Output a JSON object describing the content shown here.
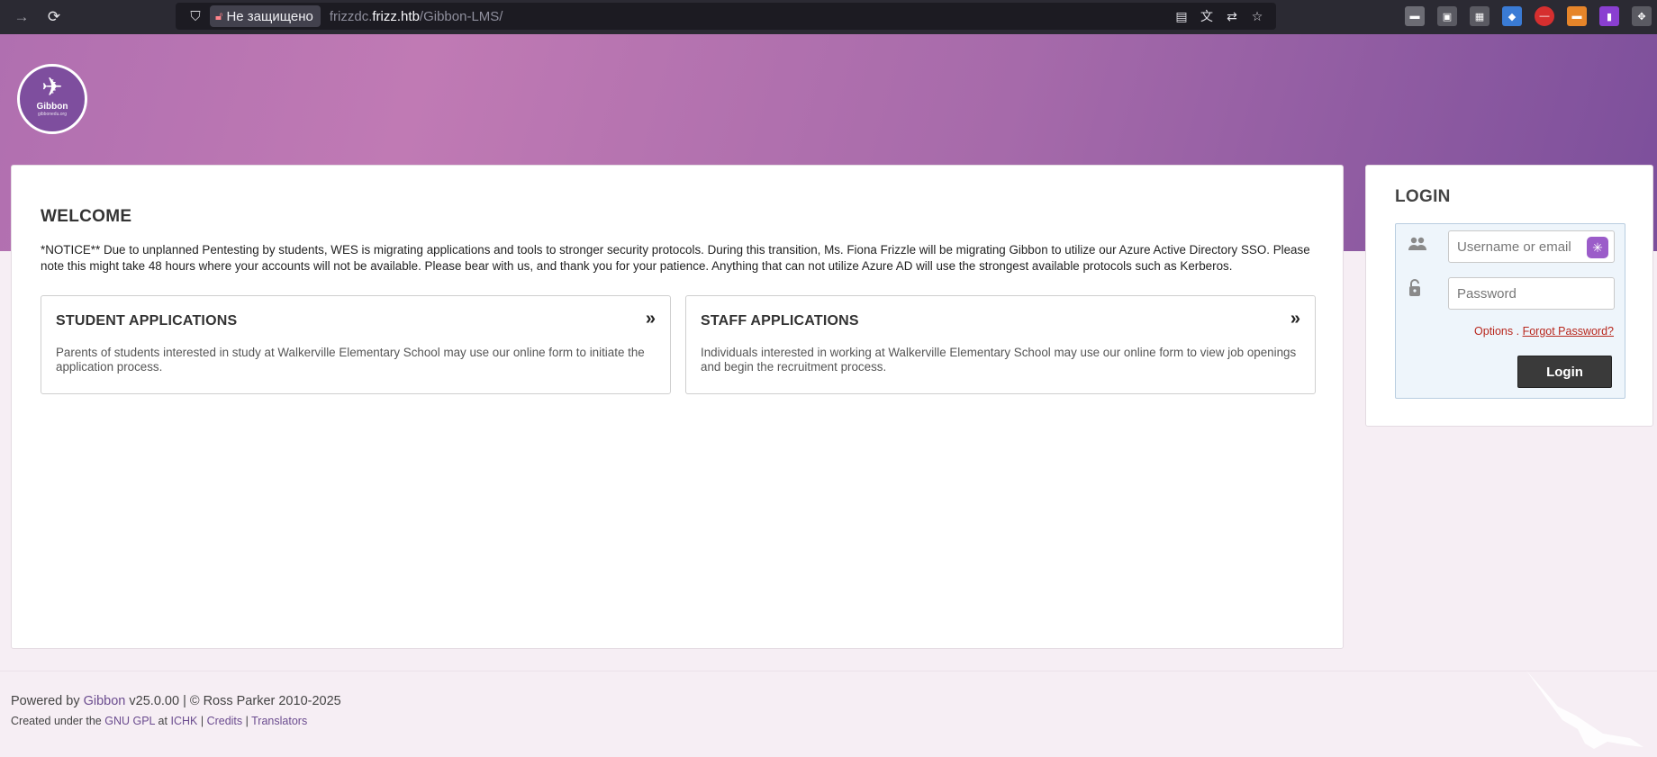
{
  "browser": {
    "security_label": "Не защищено",
    "url_prefix": "frizzdc.",
    "url_host": "frizz.htb",
    "url_path": "/Gibbon-LMS/"
  },
  "colors": {
    "brand_purple": "#7e4e9e",
    "link_red": "#b8271d",
    "button_dark": "#3a3a3a"
  },
  "logo": {
    "name": "Gibbon",
    "sub": "gibbonedu.org"
  },
  "welcome": {
    "title": "WELCOME",
    "notice": "*NOTICE** Due to unplanned Pentesting by students, WES is migrating applications and tools to stronger security protocols. During this transition, Ms. Fiona Frizzle will be migrating Gibbon to utilize our Azure Active Directory SSO. Please note this might take 48 hours where your accounts will not be available. Please bear with us, and thank you for your patience. Anything that can not utilize Azure AD will use the strongest available protocols such as Kerberos."
  },
  "applications": {
    "student": {
      "title": "STUDENT APPLICATIONS",
      "description": "Parents of students interested in study at Walkerville Elementary School may use our online form to initiate the application process."
    },
    "staff": {
      "title": "STAFF APPLICATIONS",
      "description": "Individuals interested in working at Walkerville Elementary School may use our online form to view job openings and begin the recruitment process."
    }
  },
  "login": {
    "title": "LOGIN",
    "username_placeholder": "Username or email",
    "password_placeholder": "Password",
    "options_label": "Options",
    "options_separator": ".",
    "forgot_label": "Forgot Password?",
    "button_label": "Login"
  },
  "footer": {
    "powered_by": "Powered by",
    "gibbon_link": "Gibbon",
    "version": "v25.0.00 | © Ross Parker 2010-2025",
    "created_under": "Created under the",
    "gpl_link": "GNU GPL",
    "at": "at",
    "ichk_link": "ICHK",
    "sep1": "|",
    "credits_link": "Credits",
    "sep2": "|",
    "translators_link": "Translators"
  }
}
